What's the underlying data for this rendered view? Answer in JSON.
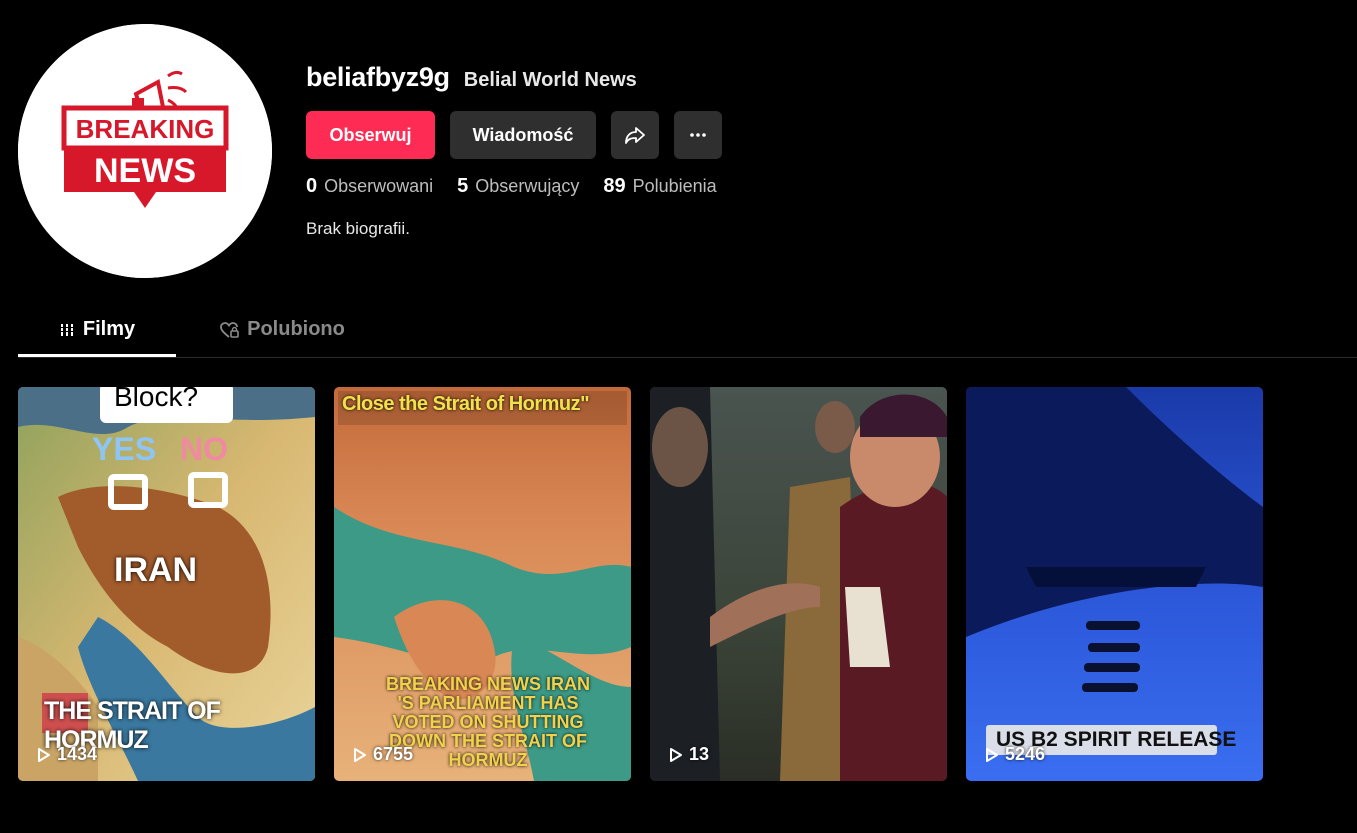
{
  "profile": {
    "username": "beliafbyz9g",
    "nickname": "Belial World News",
    "avatar_text_top": "BREAKING",
    "avatar_text_bottom": "NEWS",
    "bio": "Brak biografii."
  },
  "actions": {
    "follow_label": "Obserwuj",
    "message_label": "Wiadomość",
    "share_icon": "share-icon",
    "more_icon": "more-icon"
  },
  "stats": {
    "following": {
      "value": "0",
      "label": "Obserwowani"
    },
    "followers": {
      "value": "5",
      "label": "Obserwujący"
    },
    "likes": {
      "value": "89",
      "label": "Polubienia"
    }
  },
  "tabs": {
    "videos": "Filmy",
    "liked": "Polubiono",
    "active": "videos"
  },
  "videos": [
    {
      "views": "1434",
      "overlay": {
        "top": "Block?",
        "yes": "YES",
        "no": "NO",
        "center": "IRAN",
        "bottom": "THE STRAIT OF HORMUZ"
      }
    },
    {
      "views": "6755",
      "overlay": {
        "top": "Close the Strait of Hormuz\"",
        "bottom_lines": [
          "BREAKING NEWS  IRAN",
          "'S PARLIAMENT HAS",
          "VOTED ON SHUTTING",
          "DOWN THE STRAIT OF",
          "HORMUZ"
        ]
      }
    },
    {
      "views": "13"
    },
    {
      "views": "5246",
      "overlay": {
        "caption": "US B2 SPIRIT RELEASE"
      }
    }
  ],
  "colors": {
    "accent": "#fe2c55",
    "button_dark": "#2f2f2f",
    "background": "#000000"
  }
}
